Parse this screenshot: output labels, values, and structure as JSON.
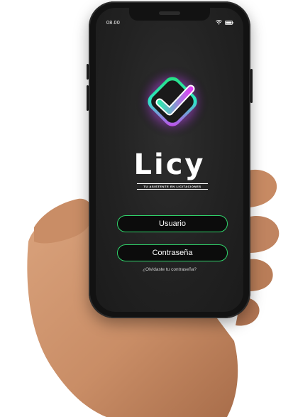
{
  "status_bar": {
    "time": "08.00",
    "wifi_icon": "wifi-icon",
    "battery_icon": "battery-icon"
  },
  "app": {
    "logo_icon": "checkmark-diamond-icon",
    "brand_name": "Licy",
    "tagline": "TU ASISTENTE EN LICITACIONES"
  },
  "login": {
    "username_placeholder": "Usuario",
    "password_placeholder": "Contraseña",
    "forgot_password_link": "¿Olvidaste tu contraseña?"
  },
  "colors": {
    "accent_green": "#2fd66b",
    "accent_magenta": "#d63af0",
    "accent_teal": "#2ee6c8",
    "screen_bg": "#222222"
  }
}
